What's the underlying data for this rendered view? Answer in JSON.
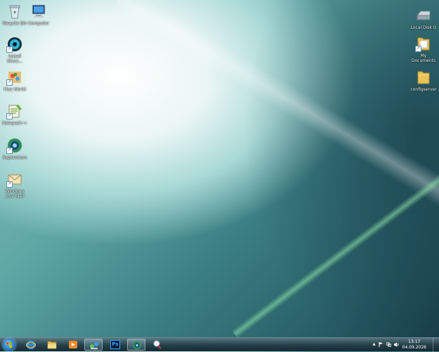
{
  "desktop_icons_left": [
    {
      "label": "Recycle Bin"
    },
    {
      "label": "Computer"
    },
    {
      "label": "Install\nMicro..."
    },
    {
      "label": "Plus World"
    },
    {
      "label": "Notepad++"
    },
    {
      "label": "Supermium"
    },
    {
      "label": "Windows\nLive Mail"
    }
  ],
  "desktop_icons_right": [
    {
      "label": "Local Disk D"
    },
    {
      "label": "My\nDocuments"
    },
    {
      "label": "configserver"
    }
  ],
  "taskbar": {
    "pinned": [
      {
        "icon": "internet-explorer-icon"
      },
      {
        "icon": "file-explorer-icon"
      },
      {
        "icon": "media-player-icon"
      },
      {
        "icon": "network-icon"
      },
      {
        "icon": "photoshop-icon",
        "text": "Ps"
      },
      {
        "icon": "supermium-icon"
      },
      {
        "icon": "magnifier-icon"
      }
    ],
    "tray_arrow": "▲",
    "clock_time": "13:17",
    "clock_date": "04.09.2026"
  }
}
